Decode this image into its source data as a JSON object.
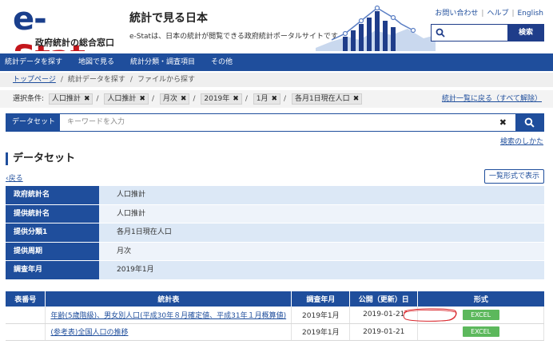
{
  "header": {
    "logo_main": "e-",
    "logo_accent": "Stat",
    "logo_sub": "政府統計の総合窓口",
    "title": "統計で見る日本",
    "description": "e-Statは、日本の統計が閲覧できる政府統計ポータルサイトです",
    "links": [
      "お問い合わせ",
      "ヘルプ",
      "English"
    ],
    "search_button": "検索"
  },
  "nav": [
    "統計データを探す",
    "地図で見る",
    "統計分類・調査項目",
    "その他"
  ],
  "breadcrumb": {
    "home": "トップページ",
    "level2": "統計データを探す",
    "current": "ファイルから探す"
  },
  "conditions": {
    "label": "選択条件:",
    "chips": [
      "人口推計",
      "人口推計",
      "月次",
      "2019年",
      "1月",
      "各月1日現在人口"
    ],
    "reset": "統計一覧に戻る（すべて解除）"
  },
  "dataset_search": {
    "select": "データセット",
    "placeholder": "キーワードを入力",
    "howto": "検索のしかた"
  },
  "section": {
    "title": "データセット",
    "back": "戻る",
    "list_button": "一覧形式で表示"
  },
  "info": [
    {
      "key": "政府統計名",
      "value": "人口推計"
    },
    {
      "key": "提供統計名",
      "value": "人口推計"
    },
    {
      "key": "提供分類1",
      "value": "各月1日現在人口"
    },
    {
      "key": "提供周期",
      "value": "月次"
    },
    {
      "key": "調査年月",
      "value": "2019年1月"
    }
  ],
  "stats_table": {
    "headers": [
      "表番号",
      "統計表",
      "調査年月",
      "公開（更新）日",
      "形式"
    ],
    "rows": [
      {
        "no": "",
        "title": "年齢(5歳階級)、男女別人口(平成30年８月確定値、平成31年１月概算値)",
        "period": "2019年1月",
        "date": "2019-01-21",
        "format": "EXCEL"
      },
      {
        "no": "",
        "title": "(参考表)全国人口の推移",
        "period": "2019年1月",
        "date": "2019-01-21",
        "format": "EXCEL"
      }
    ]
  },
  "colors": {
    "brand_blue": "#1f4e9c",
    "logo_red": "#c4161c",
    "excel_green": "#5cb85c",
    "annotation_red": "#d9262b"
  }
}
